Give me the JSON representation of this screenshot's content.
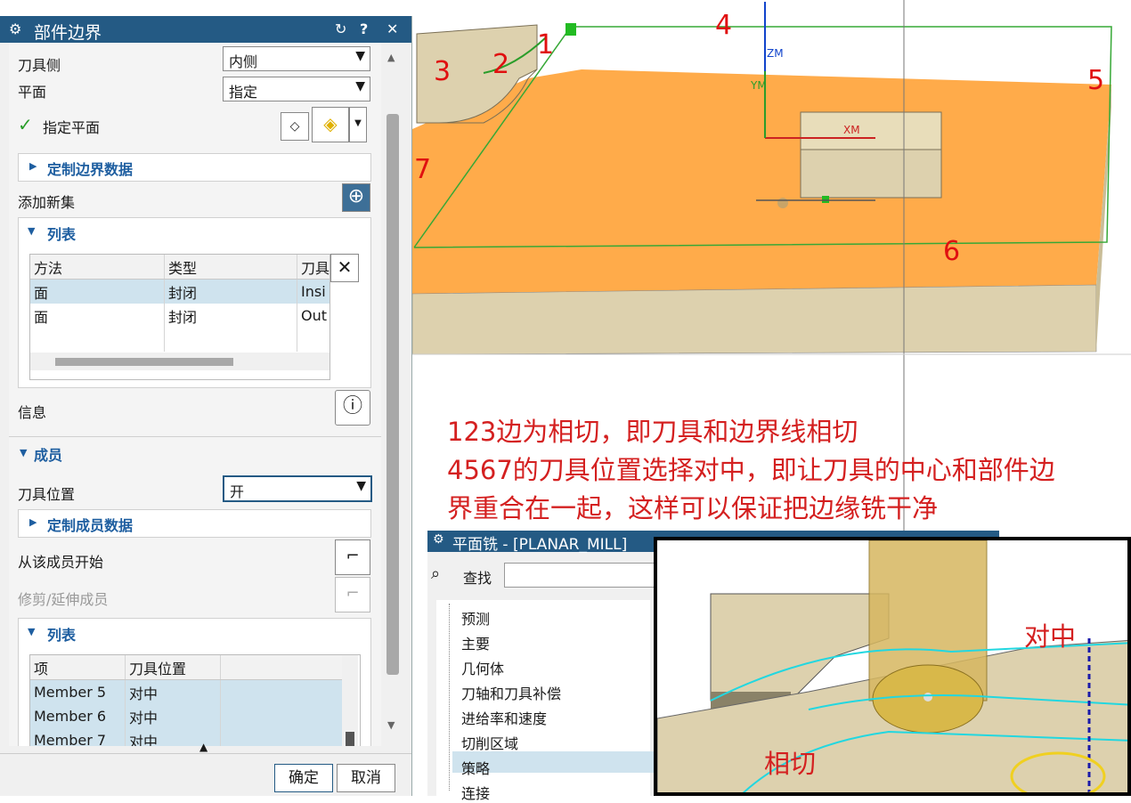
{
  "dialog": {
    "title": "部件边界",
    "title_buttons": [
      "↻",
      "?",
      "✕"
    ],
    "rows": {
      "tool_side_label": "刀具侧",
      "tool_side_value": "内侧",
      "plane_label": "平面",
      "plane_value": "指定",
      "specify_plane_label": "指定平面",
      "custom_boundary_label": "定制边界数据",
      "add_new_set_label": "添加新集",
      "list_label": "列表",
      "info_label": "信息"
    },
    "list_table": {
      "columns": [
        "方法",
        "类型",
        "刀具"
      ],
      "rows": [
        [
          "面",
          "封闭",
          "Insi"
        ],
        [
          "面",
          "封闭",
          "Out"
        ]
      ]
    },
    "members": {
      "section_label": "成员",
      "tool_position_label": "刀具位置",
      "tool_position_value": "开",
      "custom_member_label": "定制成员数据",
      "start_from_member_label": "从该成员开始",
      "trim_extend_label": "修剪/延伸成员",
      "list_label": "列表",
      "columns": [
        "项",
        "刀具位置"
      ],
      "rows": [
        [
          "Member 5",
          "对中"
        ],
        [
          "Member 6",
          "对中"
        ],
        [
          "Member 7",
          "对中"
        ]
      ]
    },
    "ok_label": "确定",
    "cancel_label": "取消"
  },
  "viewport": {
    "axis_labels": {
      "zm": "ZM",
      "ym": "YM",
      "xm": "XM"
    },
    "edge_marks": [
      "1",
      "2",
      "3",
      "4",
      "5",
      "6",
      "7"
    ],
    "note_lines": [
      "123边为相切，即刀具和边界线相切",
      "4567的刀具位置选择对中，即让刀具的中心和部件边",
      "界重合在一起，这样可以保证把边缘铣干净"
    ]
  },
  "planar_mill": {
    "title": "平面铣 - [PLANAR_MILL]",
    "find_label": "查找",
    "tree": [
      "预测",
      "主要",
      "几何体",
      "刀轴和刀具补偿",
      "进给率和速度",
      "切削区域",
      "策略",
      "连接"
    ]
  },
  "inset": {
    "center_label": "对中",
    "tangent_label": "相切"
  },
  "colors": {
    "accent": "#245a84",
    "note": "#d42020",
    "part_top": "#ffab4a",
    "part_side": "#ddd1ae"
  }
}
